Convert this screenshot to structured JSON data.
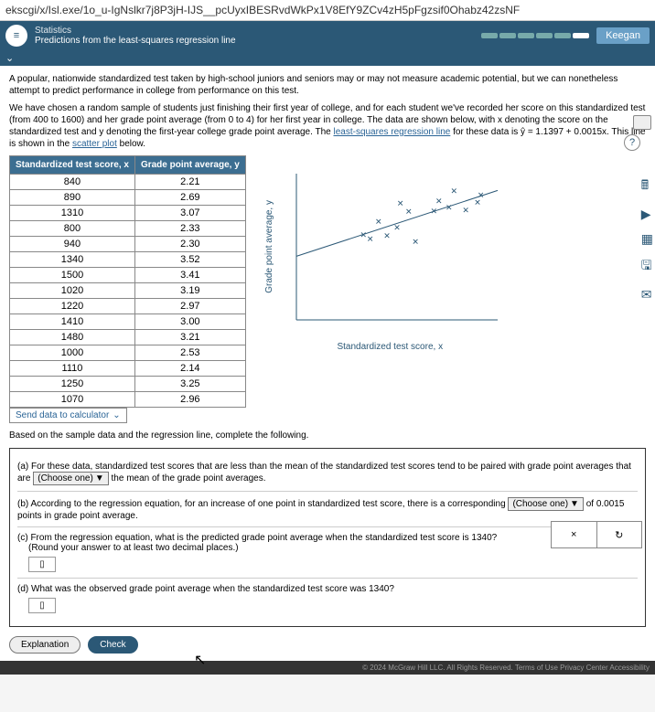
{
  "url": "ekscgi/x/Isl.exe/1o_u-IgNslkr7j8P3jH-IJS__pcUyxIBESRvdWkPx1V8EfY9ZCv4zH5pFgzsif0Ohabz42zsNF",
  "header": {
    "line1": "Statistics",
    "line2": "Predictions from the least-squares regression line",
    "user": "Keegan"
  },
  "intro": {
    "p1a": "A popular, nationwide standardized test taken by high-school juniors and seniors may or may not measure academic potential, but we can nonetheless attempt to predict performance in college from performance on this test.",
    "p2a": "We have chosen a random sample of students just finishing their first year of college, and for each student we've recorded her score on this standardized test (from 400 to 1600) and her grade point average (from 0 to 4) for her first year in college. The data are shown below, with x denoting the score on the standardized test and y denoting the first-year college grade point average. The ",
    "link1": "least-squares regression line",
    "p2b": " for these data is ŷ = 1.1397 + 0.0015x. This line is shown in the ",
    "link2": "scatter plot",
    "p2c": " below."
  },
  "table": {
    "h1": "Standardized test score, x",
    "h2": "Grade point average, y",
    "rows": [
      [
        "840",
        "2.21"
      ],
      [
        "890",
        "2.69"
      ],
      [
        "1310",
        "3.07"
      ],
      [
        "800",
        "2.33"
      ],
      [
        "940",
        "2.30"
      ],
      [
        "1340",
        "3.52"
      ],
      [
        "1500",
        "3.41"
      ],
      [
        "1020",
        "3.19"
      ],
      [
        "1220",
        "2.97"
      ],
      [
        "1410",
        "3.00"
      ],
      [
        "1480",
        "3.21"
      ],
      [
        "1000",
        "2.53"
      ],
      [
        "1110",
        "2.14"
      ],
      [
        "1250",
        "3.25"
      ],
      [
        "1070",
        "2.96"
      ]
    ],
    "send": "Send data to calculator"
  },
  "chart": {
    "ylabel": "Grade point average, y",
    "xlabel": "Standardized test score, x"
  },
  "chart_data": {
    "type": "scatter",
    "xlabel": "Standardized test score, x",
    "ylabel": "Grade point average, y",
    "xlim": [
      400,
      1600
    ],
    "ylim": [
      0,
      4
    ],
    "points": [
      {
        "x": 840,
        "y": 2.21
      },
      {
        "x": 890,
        "y": 2.69
      },
      {
        "x": 1310,
        "y": 3.07
      },
      {
        "x": 800,
        "y": 2.33
      },
      {
        "x": 940,
        "y": 2.3
      },
      {
        "x": 1340,
        "y": 3.52
      },
      {
        "x": 1500,
        "y": 3.41
      },
      {
        "x": 1020,
        "y": 3.19
      },
      {
        "x": 1220,
        "y": 2.97
      },
      {
        "x": 1410,
        "y": 3.0
      },
      {
        "x": 1480,
        "y": 3.21
      },
      {
        "x": 1000,
        "y": 2.53
      },
      {
        "x": 1110,
        "y": 2.14
      },
      {
        "x": 1250,
        "y": 3.25
      },
      {
        "x": 1070,
        "y": 2.96
      }
    ],
    "regression": {
      "intercept": 1.1397,
      "slope": 0.0015
    }
  },
  "prompt": "Based on the sample data and the regression line, complete the following.",
  "q": {
    "a1": "(a) For these data, standardized test scores that are less than the mean of the standardized test scores tend to be paired with grade point averages that are ",
    "a_sel": "(Choose one)",
    "a2": " the mean of the grade point averages.",
    "b1": "(b) According to the regression equation, for an increase of one point in standardized test score, there is a corresponding ",
    "b_sel": "(Choose one)",
    "b2": " of 0.0015 points in grade point average.",
    "c1": "(c) From the regression equation, what is the predicted grade point average when the standardized test score is 1340?",
    "c2": "(Round your answer to at least two decimal places.)",
    "d1": "(d) What was the observed grade point average when the standardized test score was 1340?"
  },
  "float": {
    "x": "×",
    "r": "↻"
  },
  "buttons": {
    "exp": "Explanation",
    "check": "Check"
  },
  "footer": "© 2024 McGraw Hill LLC. All Rights Reserved.   Terms of Use   Privacy Center   Accessibility"
}
